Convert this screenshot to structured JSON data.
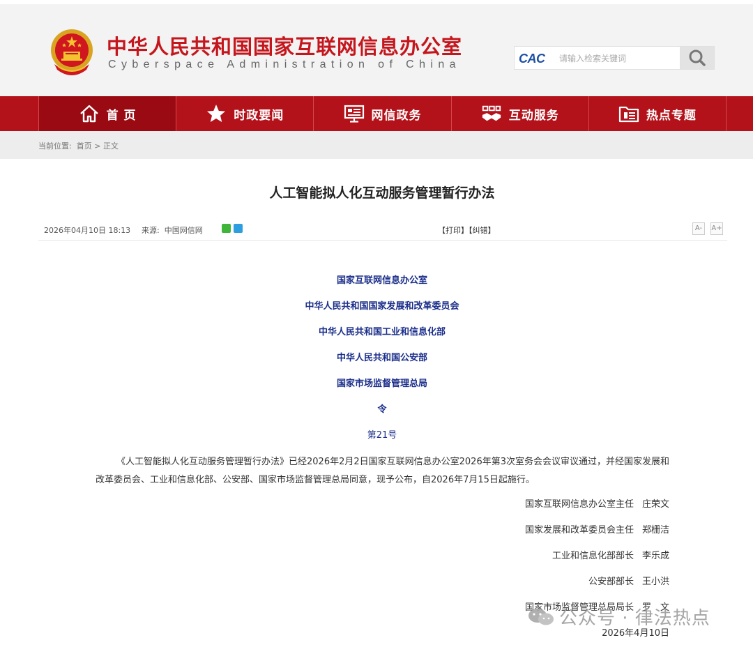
{
  "header": {
    "site_title": "中华人民共和国国家互联网信息办公室",
    "site_subtitle": "Cyberspace Administration of China",
    "logo_text": "CAC",
    "search_placeholder": "请输入检索关键词"
  },
  "nav": {
    "items": [
      {
        "label": "首 页",
        "icon": "home-icon"
      },
      {
        "label": "时政要闻",
        "icon": "star-icon"
      },
      {
        "label": "网信政务",
        "icon": "monitor-icon"
      },
      {
        "label": "互动服务",
        "icon": "handshake-icon"
      },
      {
        "label": "热点专题",
        "icon": "folder-icon"
      }
    ]
  },
  "breadcrumb": {
    "prefix": "当前位置:",
    "home": "首页",
    "separator": ">",
    "current": "正文"
  },
  "article": {
    "title": "人工智能拟人化互动服务管理暂行办法",
    "date": "2026年04月10日 18:13",
    "source_label": "来源:",
    "source": "中国网信网",
    "print": "【打印】",
    "correct": "【纠错】",
    "font_small": "A-",
    "font_large": "A+",
    "issuers": [
      "国家互联网信息办公室",
      "中华人民共和国国家发展和改革委员会",
      "中华人民共和国工业和信息化部",
      "中华人民共和国公安部",
      "国家市场监督管理总局"
    ],
    "order_word": "令",
    "order_number": "第21号",
    "paragraph": "《人工智能拟人化互动服务管理暂行办法》已经2026年2月2日国家互联网信息办公室2026年第3次室务会会议审议通过，并经国家发展和改革委员会、工业和信息化部、公安部、国家市场监督管理总局同意，现予公布，自2026年7月15日起施行。",
    "signatures": [
      {
        "title": "国家互联网信息办公室主任",
        "name": "庄荣文"
      },
      {
        "title": "国家发展和改革委员会主任",
        "name": "郑栅洁"
      },
      {
        "title": "工业和信息化部部长",
        "name": "李乐成"
      },
      {
        "title": "公安部部长",
        "name": "王小洪"
      },
      {
        "title": "国家市场监督管理总局局长",
        "name": "罗　文"
      }
    ],
    "sign_date": "2026年4月10日"
  },
  "watermark": "公众号 · 律法热点",
  "colors": {
    "brand_red": "#c4161c",
    "nav_red": "#b3121a",
    "issuer_blue": "#1b2e8a"
  }
}
